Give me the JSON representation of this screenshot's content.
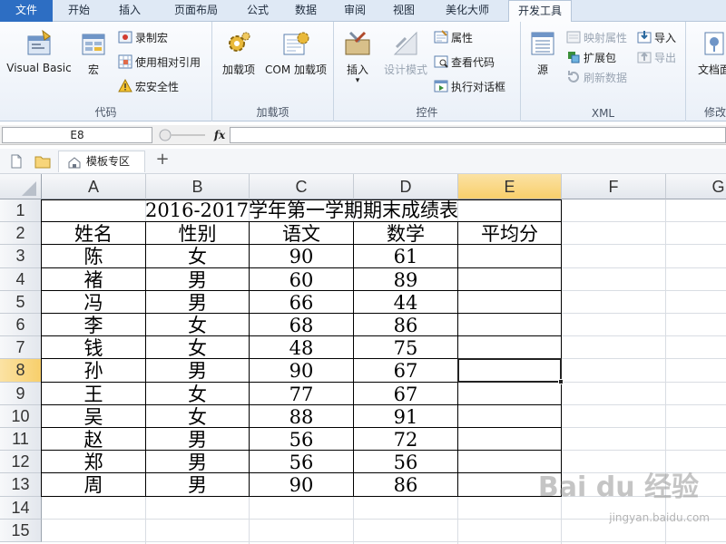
{
  "tabs": [
    "文件",
    "开始",
    "插入",
    "页面布局",
    "公式",
    "数据",
    "审阅",
    "视图",
    "美化大师",
    "开发工具"
  ],
  "active_tab": "开发工具",
  "ribbon": {
    "code": {
      "label": "代码",
      "visual_basic": "Visual Basic",
      "macros": "宏",
      "record_macro": "录制宏",
      "use_relative": "使用相对引用",
      "macro_security": "宏安全性"
    },
    "addins": {
      "label": "加载项",
      "addins": "加载项",
      "com_addins": "COM 加载项"
    },
    "controls": {
      "label": "控件",
      "insert": "插入",
      "design_mode": "设计模式",
      "properties": "属性",
      "view_code": "查看代码",
      "run_dialog": "执行对话框"
    },
    "xml": {
      "label": "XML",
      "source": "源",
      "map_properties": "映射属性",
      "expansion_packs": "扩展包",
      "refresh_data": "刷新数据",
      "import": "导入",
      "export": "导出"
    },
    "modify": {
      "label": "修改",
      "doc_panel": "文档面"
    }
  },
  "formula_bar": {
    "name_box": "E8",
    "fx": "fx",
    "value": ""
  },
  "doc_tabs": {
    "template_zone": "模板专区",
    "add": "+"
  },
  "sheet": {
    "columns": [
      "A",
      "B",
      "C",
      "D",
      "E",
      "F",
      "G"
    ],
    "rows": [
      "1",
      "2",
      "3",
      "4",
      "5",
      "6",
      "7",
      "8",
      "9",
      "10",
      "11",
      "12",
      "13",
      "14",
      "15"
    ],
    "selected_cell": "E8",
    "title": "2016-2017学年第一学期期末成绩表",
    "headers": [
      "姓名",
      "性别",
      "语文",
      "数学",
      "平均分"
    ],
    "records": [
      [
        "陈",
        "女",
        "90",
        "61",
        ""
      ],
      [
        "褚",
        "男",
        "60",
        "89",
        ""
      ],
      [
        "冯",
        "男",
        "66",
        "44",
        ""
      ],
      [
        "李",
        "女",
        "68",
        "86",
        ""
      ],
      [
        "钱",
        "女",
        "48",
        "75",
        ""
      ],
      [
        "孙",
        "男",
        "90",
        "67",
        ""
      ],
      [
        "王",
        "女",
        "77",
        "67",
        ""
      ],
      [
        "吴",
        "女",
        "88",
        "91",
        ""
      ],
      [
        "赵",
        "男",
        "56",
        "72",
        ""
      ],
      [
        "郑",
        "男",
        "56",
        "56",
        ""
      ],
      [
        "周",
        "男",
        "90",
        "86",
        ""
      ]
    ]
  },
  "watermark": {
    "logo": "Bai du 经验",
    "url": "jingyan.baidu.com"
  },
  "colors": {
    "file_tab": "#2d6ec3",
    "selection_header": "#f8cf6b",
    "ribbon_bg": "#eaf0f8"
  }
}
